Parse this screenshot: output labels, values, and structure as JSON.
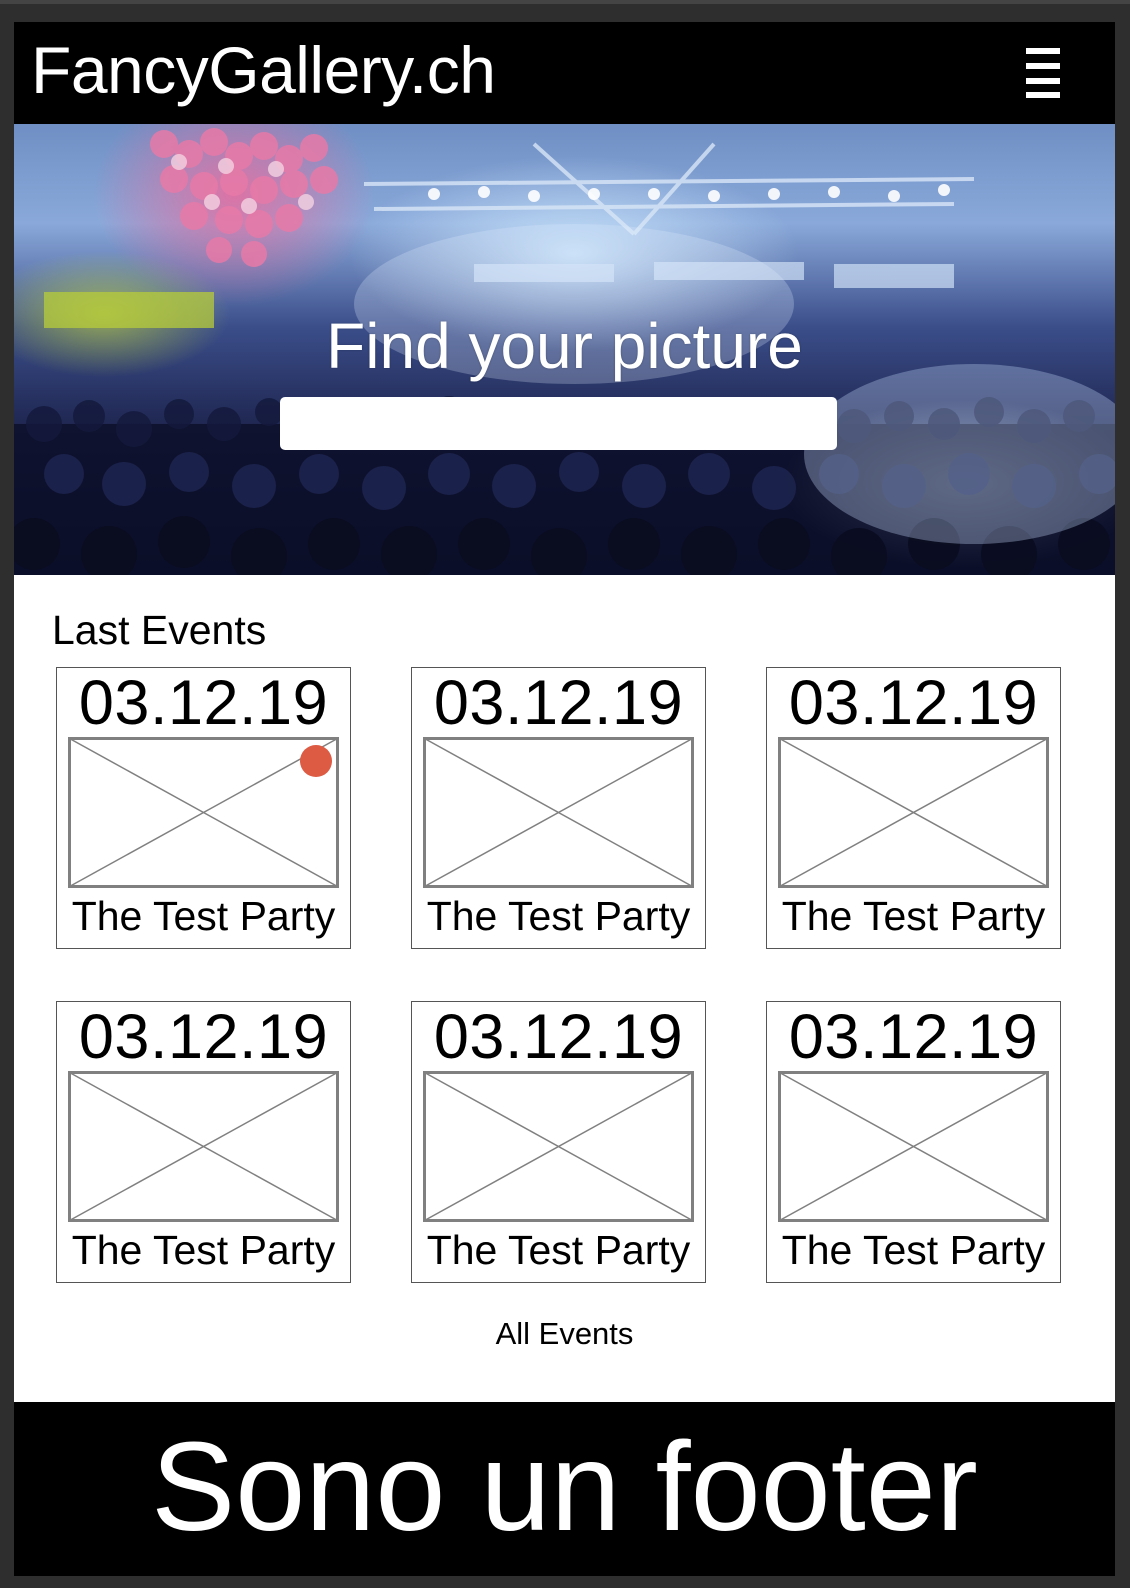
{
  "header": {
    "logo": "FancyGallery.ch",
    "menu_icon": "hamburger-menu-icon"
  },
  "hero": {
    "title": "Find your picture",
    "search_value": "",
    "search_placeholder": ""
  },
  "events": {
    "section_title": "Last Events",
    "items": [
      {
        "date": "03.12.19",
        "name": "The Test Party",
        "image": "image-placeholder-icon",
        "marker": "red-dot",
        "marker_color": "#dd5a43"
      },
      {
        "date": "03.12.19",
        "name": "The Test Party",
        "image": "image-placeholder-icon"
      },
      {
        "date": "03.12.19",
        "name": "The Test Party",
        "image": "image-placeholder-icon"
      },
      {
        "date": "03.12.19",
        "name": "The Test Party",
        "image": "image-placeholder-icon"
      },
      {
        "date": "03.12.19",
        "name": "The Test Party",
        "image": "image-placeholder-icon"
      },
      {
        "date": "03.12.19",
        "name": "The Test Party",
        "image": "image-placeholder-icon"
      }
    ],
    "all_events_label": "All Events"
  },
  "footer": {
    "text": "Sono un footer"
  },
  "colors": {
    "header_bg": "#000000",
    "footer_bg": "#000000",
    "frame_bg": "#2e2e2e",
    "page_bg": "#ffffff",
    "marker": "#dd5a43",
    "placeholder_stroke": "#808080"
  }
}
